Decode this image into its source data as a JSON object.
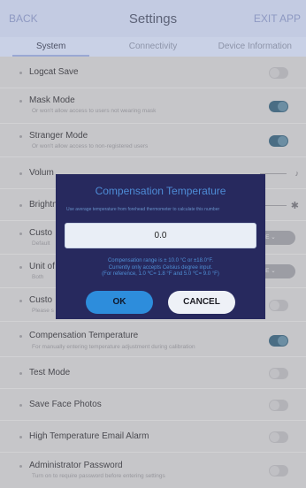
{
  "header": {
    "back_label": "BACK",
    "title": "Settings",
    "exit_label": "EXIT APP"
  },
  "tabs": [
    {
      "label": "System",
      "active": true
    },
    {
      "label": "Connectivity",
      "active": false
    },
    {
      "label": "Device Information",
      "active": false
    }
  ],
  "settings": {
    "logcat_save": {
      "label": "Logcat Save",
      "toggle": "off"
    },
    "mask_mode": {
      "label": "Mask Mode",
      "desc": "Or won't allow access to users not wearing mask",
      "toggle": "on"
    },
    "stranger_mode": {
      "label": "Stranger Mode",
      "desc": "Or won't allow access to non-registered users",
      "toggle": "on"
    },
    "volume": {
      "label": "Volum"
    },
    "brightness": {
      "label": "Brightn"
    },
    "custom_display": {
      "label": "Custo",
      "desc": "Default",
      "select_value": "ANGE"
    },
    "unit": {
      "label": "Unit of",
      "desc": "Both",
      "select_value": "ANGE"
    },
    "custom_other": {
      "label": "Custo",
      "desc": "Please s",
      "toggle": "off"
    },
    "compensation_temp": {
      "label": "Compensation Temperature",
      "desc": "For manually entering temperature adjustment during calibration",
      "toggle": "on"
    },
    "test_mode": {
      "label": "Test Mode",
      "toggle": "off"
    },
    "save_face_photos": {
      "label": "Save Face Photos",
      "toggle": "off"
    },
    "high_temp_email": {
      "label": "High Temperature Email Alarm",
      "toggle": "off"
    },
    "admin_password": {
      "label": "Administrator Password",
      "desc": "Turn on to require password before entering settings",
      "toggle": "off"
    }
  },
  "dialog": {
    "title": "Compensation Temperature",
    "hint": "Use average temperature from forehead thermometer to calculate this number",
    "input_value": "0.0",
    "note_line1": "Compensation range is ± 10.0 °C or ±18.0°F.",
    "note_line2": "Currently only accepts Celsius degree input.",
    "note_line3": "(For reference, 1.0 ℃= 1.8 °F and 5.0 ℃= 9.0 °F)",
    "ok_label": "OK",
    "cancel_label": "CANCEL"
  },
  "icons": {
    "volume": "speaker-icon",
    "brightness": "sun-icon",
    "select": "chevron-down-icon"
  },
  "colors": {
    "toggle_on": "#4a6d84",
    "ok_button": "#2d8ddc",
    "dialog_bg": "#27295e",
    "dialog_text": "#4e8cd6"
  }
}
